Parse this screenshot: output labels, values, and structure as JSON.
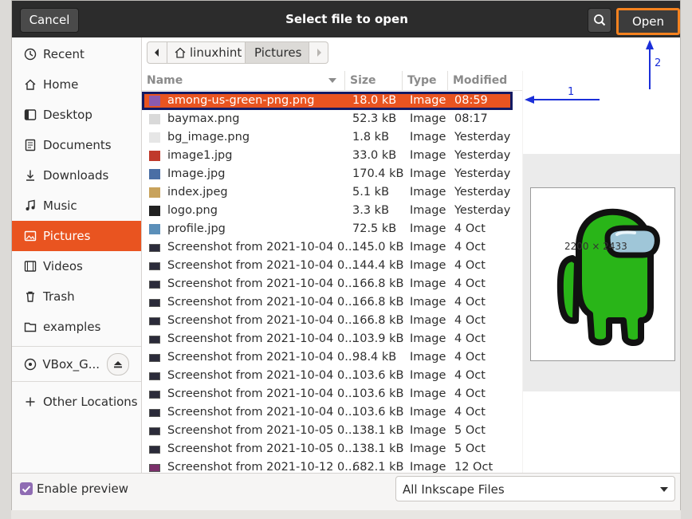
{
  "dialog": {
    "title": "Select file to open",
    "cancel_label": "Cancel",
    "open_label": "Open"
  },
  "sidebar": {
    "items": [
      {
        "label": "Recent",
        "icon": "clock-icon"
      },
      {
        "label": "Home",
        "icon": "home-icon"
      },
      {
        "label": "Desktop",
        "icon": "desktop-icon"
      },
      {
        "label": "Documents",
        "icon": "document-icon"
      },
      {
        "label": "Downloads",
        "icon": "download-icon"
      },
      {
        "label": "Music",
        "icon": "music-icon"
      },
      {
        "label": "Pictures",
        "icon": "picture-icon",
        "active": true
      },
      {
        "label": "Videos",
        "icon": "video-icon"
      },
      {
        "label": "Trash",
        "icon": "trash-icon"
      },
      {
        "label": "examples",
        "icon": "folder-icon"
      }
    ],
    "device": {
      "label": "VBox_G...",
      "icon": "disc-icon"
    },
    "other": {
      "label": "Other Locations",
      "icon": "plus-icon"
    }
  },
  "pathbar": {
    "home": "linuxhint",
    "current": "Pictures"
  },
  "columns": {
    "name": "Name",
    "size": "Size",
    "type": "Type",
    "modified": "Modified"
  },
  "files": [
    {
      "name": "among-us-green-png.png",
      "size": "18.0 kB",
      "type": "Image",
      "modified": "08:59",
      "selected": true
    },
    {
      "name": "baymax.png",
      "size": "52.3 kB",
      "type": "Image",
      "modified": "08:17"
    },
    {
      "name": "bg_image.png",
      "size": "1.8 kB",
      "type": "Image",
      "modified": "Yesterday"
    },
    {
      "name": "image1.jpg",
      "size": "33.0 kB",
      "type": "Image",
      "modified": "Yesterday"
    },
    {
      "name": "Image.jpg",
      "size": "170.4 kB",
      "type": "Image",
      "modified": "Yesterday"
    },
    {
      "name": "index.jpeg",
      "size": "5.1 kB",
      "type": "Image",
      "modified": "Yesterday"
    },
    {
      "name": "logo.png",
      "size": "3.3 kB",
      "type": "Image",
      "modified": "Yesterday"
    },
    {
      "name": "profile.jpg",
      "size": "72.5 kB",
      "type": "Image",
      "modified": "4 Oct"
    },
    {
      "name": "Screenshot from 2021-10-04 0...",
      "size": "145.0 kB",
      "type": "Image",
      "modified": "4 Oct"
    },
    {
      "name": "Screenshot from 2021-10-04 0...",
      "size": "144.4 kB",
      "type": "Image",
      "modified": "4 Oct"
    },
    {
      "name": "Screenshot from 2021-10-04 0...",
      "size": "166.8 kB",
      "type": "Image",
      "modified": "4 Oct"
    },
    {
      "name": "Screenshot from 2021-10-04 0...",
      "size": "166.8 kB",
      "type": "Image",
      "modified": "4 Oct"
    },
    {
      "name": "Screenshot from 2021-10-04 0...",
      "size": "166.8 kB",
      "type": "Image",
      "modified": "4 Oct"
    },
    {
      "name": "Screenshot from 2021-10-04 0...",
      "size": "103.9 kB",
      "type": "Image",
      "modified": "4 Oct"
    },
    {
      "name": "Screenshot from 2021-10-04 0...",
      "size": "98.4 kB",
      "type": "Image",
      "modified": "4 Oct"
    },
    {
      "name": "Screenshot from 2021-10-04 0...",
      "size": "103.6 kB",
      "type": "Image",
      "modified": "4 Oct"
    },
    {
      "name": "Screenshot from 2021-10-04 0...",
      "size": "103.6 kB",
      "type": "Image",
      "modified": "4 Oct"
    },
    {
      "name": "Screenshot from 2021-10-04 0...",
      "size": "103.6 kB",
      "type": "Image",
      "modified": "4 Oct"
    },
    {
      "name": "Screenshot from 2021-10-05 0...",
      "size": "138.1 kB",
      "type": "Image",
      "modified": "5 Oct"
    },
    {
      "name": "Screenshot from 2021-10-05 0...",
      "size": "138.1 kB",
      "type": "Image",
      "modified": "5 Oct"
    },
    {
      "name": "Screenshot from 2021-10-12 0...",
      "size": "682.1 kB",
      "type": "Image",
      "modified": "12 Oct"
    }
  ],
  "preview": {
    "size_text": "2200 × 2433"
  },
  "bottom": {
    "enable_preview": "Enable preview",
    "filter": "All Inkscape Files"
  },
  "annotations": {
    "one": "1",
    "two": "2",
    "color": "#1b2fd9"
  },
  "colors": {
    "accent": "#e95420",
    "open_outline": "#f5821f",
    "selection_outline": "#131a63"
  }
}
